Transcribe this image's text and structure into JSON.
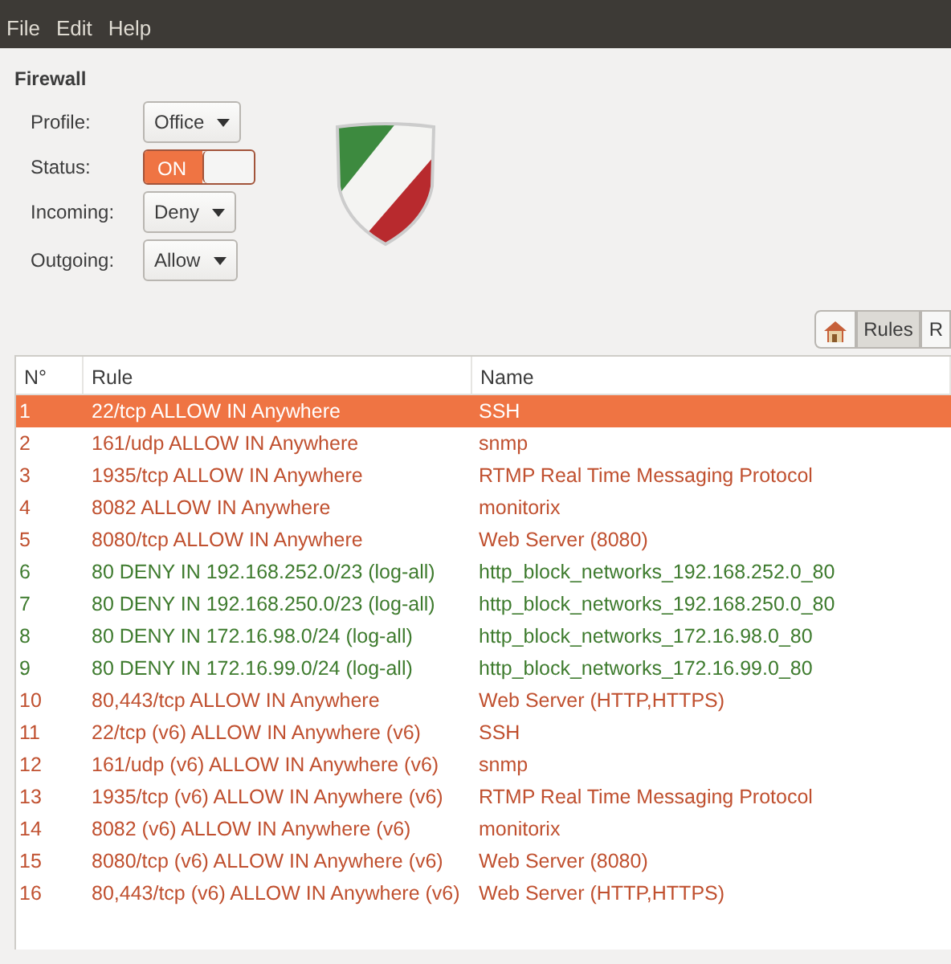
{
  "menu": [
    "File",
    "Edit",
    "Help"
  ],
  "title": "Firewall",
  "form": [
    {
      "label": "Profile:",
      "kind": "dropdown",
      "value": "Office"
    },
    {
      "label": "Status:",
      "kind": "switch",
      "value": "ON",
      "on": true
    },
    {
      "label": "Incoming:",
      "kind": "dropdown",
      "value": "Deny"
    },
    {
      "label": "Outgoing:",
      "kind": "dropdown",
      "value": "Allow"
    }
  ],
  "tabs": [
    {
      "kind": "icon",
      "selected": false
    },
    {
      "label": "Rules",
      "selected": true
    },
    {
      "label": "R",
      "selected": false
    }
  ],
  "table": {
    "columns": [
      "N°",
      "Rule",
      "Name"
    ],
    "rows": [
      {
        "n": "1",
        "rule": "22/tcp ALLOW IN Anywhere",
        "name": "SSH",
        "kind": "allow",
        "selected": true
      },
      {
        "n": "2",
        "rule": "161/udp ALLOW IN Anywhere",
        "name": "snmp",
        "kind": "allow",
        "selected": false
      },
      {
        "n": "3",
        "rule": "1935/tcp ALLOW IN Anywhere",
        "name": "RTMP Real Time Messaging Protocol",
        "kind": "allow",
        "selected": false
      },
      {
        "n": "4",
        "rule": "8082 ALLOW IN Anywhere",
        "name": "monitorix",
        "kind": "allow",
        "selected": false
      },
      {
        "n": "5",
        "rule": "8080/tcp ALLOW IN Anywhere",
        "name": "Web Server (8080)",
        "kind": "allow",
        "selected": false
      },
      {
        "n": "6",
        "rule": "80 DENY IN 192.168.252.0/23 (log-all)",
        "name": "http_block_networks_192.168.252.0_80",
        "kind": "deny",
        "selected": false
      },
      {
        "n": "7",
        "rule": "80 DENY IN 192.168.250.0/23 (log-all)",
        "name": "http_block_networks_192.168.250.0_80",
        "kind": "deny",
        "selected": false
      },
      {
        "n": "8",
        "rule": "80 DENY IN 172.16.98.0/24 (log-all)",
        "name": "http_block_networks_172.16.98.0_80",
        "kind": "deny",
        "selected": false
      },
      {
        "n": "9",
        "rule": "80 DENY IN 172.16.99.0/24 (log-all)",
        "name": "http_block_networks_172.16.99.0_80",
        "kind": "deny",
        "selected": false
      },
      {
        "n": "10",
        "rule": "80,443/tcp ALLOW IN Anywhere",
        "name": "Web Server (HTTP,HTTPS)",
        "kind": "allow",
        "selected": false
      },
      {
        "n": "11",
        "rule": "22/tcp (v6) ALLOW IN Anywhere (v6)",
        "name": "SSH",
        "kind": "allow",
        "selected": false
      },
      {
        "n": "12",
        "rule": "161/udp (v6) ALLOW IN Anywhere (v6)",
        "name": "snmp",
        "kind": "allow",
        "selected": false
      },
      {
        "n": "13",
        "rule": "1935/tcp (v6) ALLOW IN Anywhere (v6)",
        "name": "RTMP Real Time Messaging Protocol",
        "kind": "allow",
        "selected": false
      },
      {
        "n": "14",
        "rule": "8082 (v6) ALLOW IN Anywhere (v6)",
        "name": "monitorix",
        "kind": "allow",
        "selected": false
      },
      {
        "n": "15",
        "rule": "8080/tcp (v6) ALLOW IN Anywhere (v6)",
        "name": "Web Server (8080)",
        "kind": "allow",
        "selected": false
      },
      {
        "n": "16",
        "rule": "80,443/tcp (v6) ALLOW IN Anywhere (v6)",
        "name": "Web Server (HTTP,HTTPS)",
        "kind": "allow",
        "selected": false
      }
    ]
  }
}
